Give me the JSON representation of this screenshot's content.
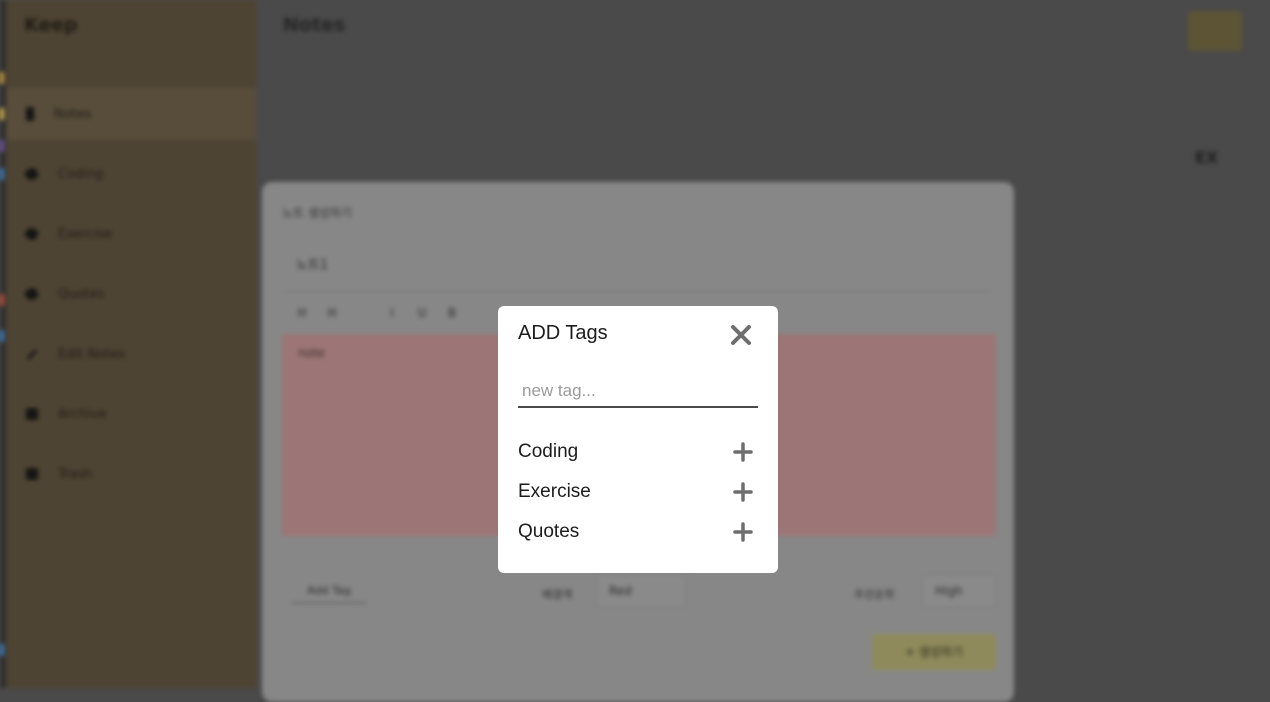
{
  "app": {
    "brand": "Keep",
    "title": "Notes",
    "sort_label": "EX"
  },
  "sidebar": {
    "items": [
      {
        "label": "Notes",
        "icon": "pin-icon"
      },
      {
        "label": "Coding",
        "icon": "tag-icon"
      },
      {
        "label": "Exercise",
        "icon": "tag-icon"
      },
      {
        "label": "Quotes",
        "icon": "tag-icon"
      },
      {
        "label": "Edit Notes",
        "icon": "pencil-icon"
      },
      {
        "label": "Archive",
        "icon": "archive-icon"
      },
      {
        "label": "Trash",
        "icon": "trash-icon"
      }
    ]
  },
  "editor": {
    "title": "노트 생성하기",
    "subject": "노트1",
    "toolbar": [
      "H",
      "H",
      "I",
      "U",
      "B"
    ],
    "body": "note",
    "add_tag_label": "Add Tag",
    "color_label": "배경색",
    "color_value": "Red",
    "priority_label": "우선순위",
    "priority_value": "High",
    "submit_label": "+ 생성하기"
  },
  "modal": {
    "title": "ADD Tags",
    "input_placeholder": "new tag...",
    "tags": [
      {
        "label": "Coding"
      },
      {
        "label": "Exercise"
      },
      {
        "label": "Quotes"
      }
    ]
  },
  "colors": {
    "overlay": "#4a4a4a",
    "sidebar": "#4e4433",
    "editor_body": "#9c7676",
    "modal_bg": "#ffffff",
    "icon_gray": "#6e6e6e"
  }
}
